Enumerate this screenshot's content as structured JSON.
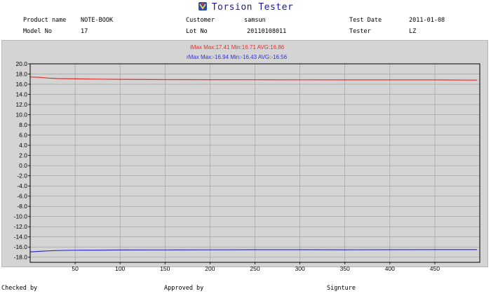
{
  "header": {
    "title": "Torsion Tester",
    "logo_icon": "torsion-logo-icon"
  },
  "info": {
    "product_name_label": "Product name",
    "product_name_value": "NOTE-BOOK",
    "customer_label": "Customer",
    "customer_value": "samsun",
    "test_date_label": "Test Date",
    "test_date_value": "2011-01-08",
    "model_no_label": "Model No",
    "model_no_value": "17",
    "lot_no_label": "Lot No",
    "lot_no_value": "20110108011",
    "tester_label": "Tester",
    "tester_value": "LZ"
  },
  "stats": {
    "i_line": "iMax   Max:17.41 Min:16.71 AVG:16.86",
    "r_line": "rMax   Max:-16.94 Min:-16.43 AVG:-16.56"
  },
  "footer": {
    "checked_by": "Checked by",
    "approved_by": "Approved by",
    "signature": "Signture"
  },
  "colors": {
    "i_series": "#e03030",
    "r_series": "#3030d0",
    "grid": "#9a9a9a",
    "plot_bg": "#d4d4d4"
  },
  "chart_data": {
    "type": "line",
    "title": "",
    "xlabel": "",
    "ylabel": "",
    "xlim": [
      0,
      500
    ],
    "ylim": [
      -19,
      20
    ],
    "x_ticks": [
      50,
      100,
      150,
      200,
      250,
      300,
      350,
      400,
      450
    ],
    "y_ticks": [
      20.0,
      18.0,
      16.0,
      14.0,
      12.0,
      10.0,
      8.0,
      6.0,
      4.0,
      2.0,
      0.0,
      -2.0,
      -4.0,
      -6.0,
      -8.0,
      -10.0,
      -12.0,
      -14.0,
      -16.0,
      -18.0
    ],
    "y_tick_labels": [
      "20.0",
      "18.0",
      "16.0",
      "14.0",
      "12.0",
      "10.0",
      "8.0",
      "6.0",
      "4.0",
      "2.0",
      "0.0",
      "-2.0",
      "-4.0",
      "-6.0",
      "-8.0",
      "-10.0",
      "-12.0",
      "-14.0",
      "-16.0",
      "-18.0"
    ],
    "grid": true,
    "series": [
      {
        "color": "#e03030",
        "x": [
          0,
          10,
          20,
          30,
          50,
          75,
          100,
          150,
          200,
          250,
          300,
          350,
          400,
          450,
          497
        ],
        "y": [
          17.41,
          17.35,
          17.2,
          17.1,
          17.05,
          17.0,
          16.95,
          16.9,
          16.88,
          16.87,
          16.86,
          16.85,
          16.85,
          16.84,
          16.8
        ]
      },
      {
        "color": "#3030d0",
        "x": [
          0,
          10,
          20,
          30,
          50,
          75,
          100,
          150,
          200,
          250,
          300,
          350,
          400,
          450,
          497
        ],
        "y": [
          -16.94,
          -16.85,
          -16.75,
          -16.68,
          -16.62,
          -16.6,
          -16.58,
          -16.56,
          -16.55,
          -16.52,
          -16.52,
          -16.53,
          -16.52,
          -16.51,
          -16.5
        ]
      }
    ]
  }
}
